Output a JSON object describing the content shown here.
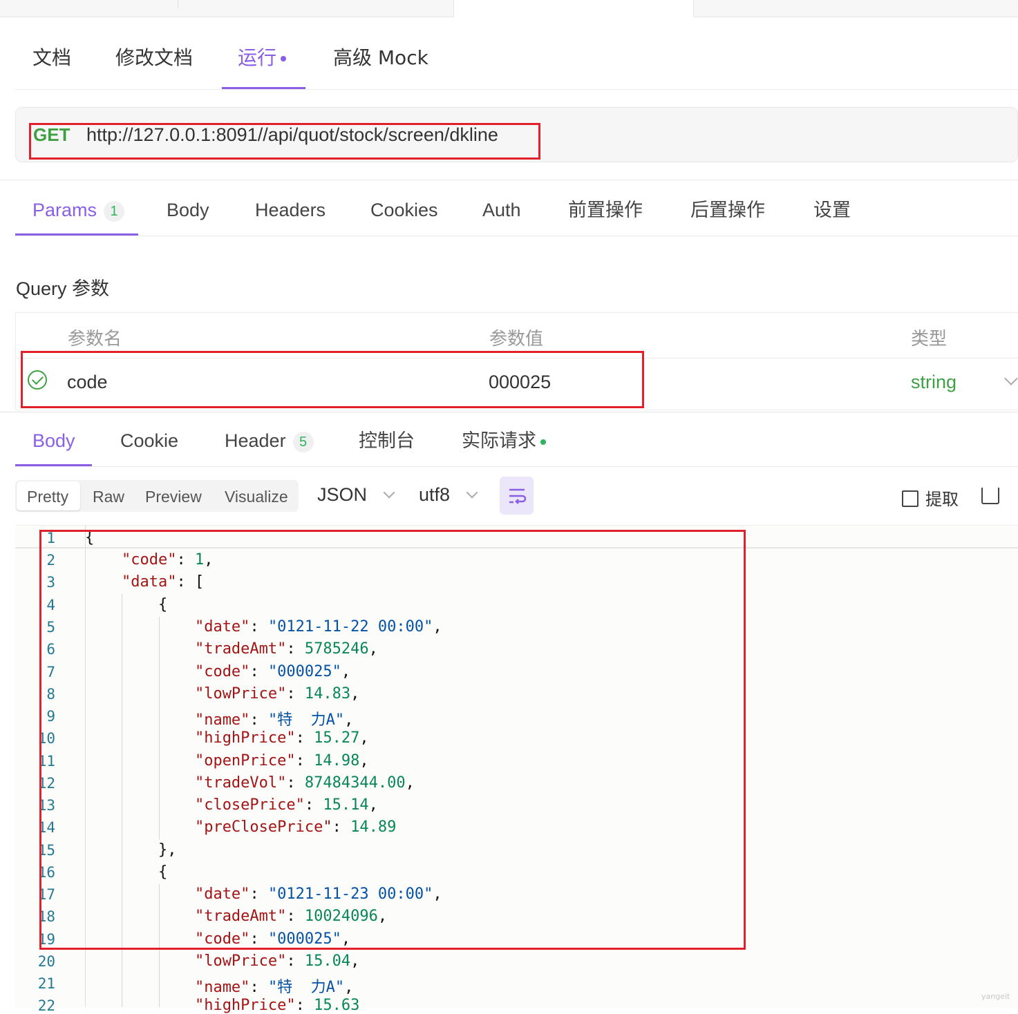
{
  "top_tabs": [
    {
      "label": "文档"
    },
    {
      "label": "修改文档"
    },
    {
      "label": "运行"
    },
    {
      "label": "高级 Mock"
    }
  ],
  "request": {
    "method": "GET",
    "url": "http://127.0.0.1:8091//api/quot/stock/screen/dkline"
  },
  "param_tabs": [
    {
      "label": "Params",
      "badge": "1"
    },
    {
      "label": "Body"
    },
    {
      "label": "Headers"
    },
    {
      "label": "Cookies"
    },
    {
      "label": "Auth"
    },
    {
      "label": "前置操作"
    },
    {
      "label": "后置操作"
    },
    {
      "label": "设置"
    }
  ],
  "query": {
    "title": "Query 参数",
    "headers": [
      "参数名",
      "参数值",
      "类型"
    ],
    "row": {
      "name": "code",
      "value": "000025",
      "type": "string"
    }
  },
  "response_tabs": [
    {
      "label": "Body"
    },
    {
      "label": "Cookie"
    },
    {
      "label": "Header",
      "badge": "5"
    },
    {
      "label": "控制台"
    },
    {
      "label": "实际请求"
    }
  ],
  "view_modes": [
    "Pretty",
    "Raw",
    "Preview",
    "Visualize"
  ],
  "format_select": "JSON",
  "encoding_select": "utf8",
  "extract_label": "提取",
  "watermark": "yangeit",
  "code_lines": [
    {
      "n": "1"
    },
    {
      "n": "2"
    },
    {
      "n": "3"
    },
    {
      "n": "4"
    },
    {
      "n": "5"
    },
    {
      "n": "6"
    },
    {
      "n": "7"
    },
    {
      "n": "8"
    },
    {
      "n": "9"
    },
    {
      "n": "10"
    },
    {
      "n": "11"
    },
    {
      "n": "12"
    },
    {
      "n": "13"
    },
    {
      "n": "14"
    },
    {
      "n": "15"
    },
    {
      "n": "16"
    },
    {
      "n": "17"
    },
    {
      "n": "18"
    },
    {
      "n": "19"
    },
    {
      "n": "20"
    },
    {
      "n": "21"
    },
    {
      "n": "22"
    }
  ],
  "json": {
    "k_code": "\"code\"",
    "v_code": "1",
    "k_data": "\"data\"",
    "k_date": "\"date\"",
    "k_tradeAmt": "\"tradeAmt\"",
    "k_lowPrice": "\"lowPrice\"",
    "k_name": "\"name\"",
    "k_highPrice": "\"highPrice\"",
    "k_openPrice": "\"openPrice\"",
    "k_tradeVol": "\"tradeVol\"",
    "k_closePrice": "\"closePrice\"",
    "k_preClosePrice": "\"preClosePrice\"",
    "r1": {
      "date": "\"0121-11-22 00:00\"",
      "tradeAmt": "5785246",
      "code": "\"000025\"",
      "lowPrice": "14.83",
      "name": "\"特  力A\"",
      "highPrice": "15.27",
      "openPrice": "14.98",
      "tradeVol": "87484344.00",
      "closePrice": "15.14",
      "preClosePrice": "14.89"
    },
    "r2": {
      "date": "\"0121-11-23 00:00\"",
      "tradeAmt": "10024096",
      "code": "\"000025\"",
      "lowPrice": "15.04",
      "name": "\"特  力A\"",
      "highPrice": "15.63"
    }
  }
}
